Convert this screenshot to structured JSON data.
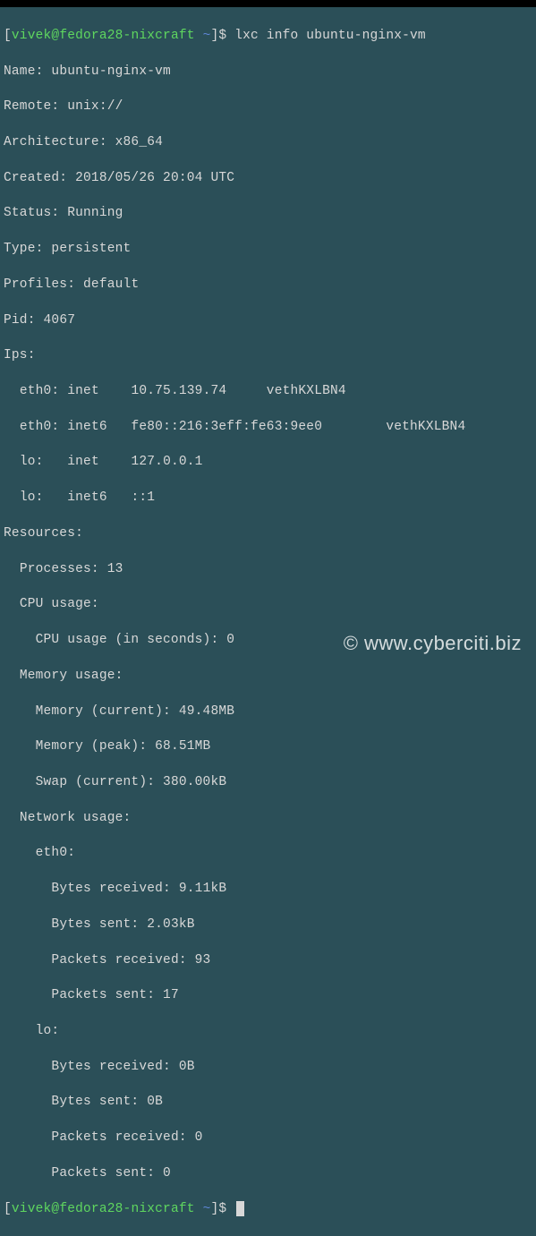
{
  "prompt": {
    "user": "vivek",
    "host": "fedora28-nixcraft",
    "path": "~",
    "symbol": "$"
  },
  "command": "lxc info ubuntu-nginx-vm",
  "info": {
    "name": "ubuntu-nginx-vm",
    "remote": "unix://",
    "architecture": "x86_64",
    "created": "2018/05/26 20:04 UTC",
    "status": "Running",
    "type": "persistent",
    "profiles": "default",
    "pid": "4067"
  },
  "labels": {
    "name": "Name:",
    "remote": "Remote:",
    "architecture": "Architecture:",
    "created": "Created:",
    "status": "Status:",
    "type": "Type:",
    "profiles": "Profiles:",
    "pid": "Pid:",
    "ips": "Ips:",
    "resources": "Resources:",
    "processes": "Processes:",
    "cpu_usage": "CPU usage:",
    "cpu_usage_sec": "CPU usage (in seconds):",
    "memory_usage": "Memory usage:",
    "memory_current": "Memory (current):",
    "memory_peak": "Memory (peak):",
    "swap_current": "Swap (current):",
    "network_usage": "Network usage:",
    "bytes_received": "Bytes received:",
    "bytes_sent": "Bytes sent:",
    "packets_received": "Packets received:",
    "packets_sent": "Packets sent:"
  },
  "ips": [
    {
      "iface": "eth0:",
      "fam": "inet",
      "addr": "10.75.139.74",
      "veth": "vethKXLBN4"
    },
    {
      "iface": "eth0:",
      "fam": "inet6",
      "addr": "fe80::216:3eff:fe63:9ee0",
      "veth": "vethKXLBN4"
    },
    {
      "iface": "lo:",
      "fam": "inet",
      "addr": "127.0.0.1",
      "veth": ""
    },
    {
      "iface": "lo:",
      "fam": "inet6",
      "addr": "::1",
      "veth": ""
    }
  ],
  "resources": {
    "processes": "13",
    "cpu_usage_sec": "0",
    "memory_current": "49.48MB",
    "memory_peak": "68.51MB",
    "swap_current": "380.00kB",
    "network": {
      "eth0": {
        "name": "eth0:",
        "bytes_received": "9.11kB",
        "bytes_sent": "2.03kB",
        "packets_received": "93",
        "packets_sent": "17"
      },
      "lo": {
        "name": "lo:",
        "bytes_received": "0B",
        "bytes_sent": "0B",
        "packets_received": "0",
        "packets_sent": "0"
      }
    }
  },
  "watermark": "©  www.cyberciti.biz"
}
